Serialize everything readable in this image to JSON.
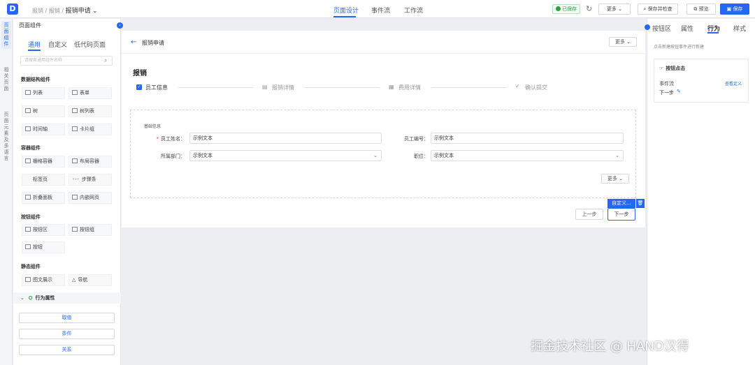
{
  "header": {
    "logo_text": "D",
    "breadcrumb": [
      "报销",
      "报销"
    ],
    "current_page": "报销申请",
    "tabs": [
      {
        "label": "页面设计",
        "active": true
      },
      {
        "label": "事件流"
      },
      {
        "label": "工作流"
      }
    ],
    "saved_label": "已保存",
    "more_label": "更多",
    "save_check_label": "保存并检查",
    "preview_label": "预览",
    "save_label": "保存",
    "accent": "#2468f2"
  },
  "left_strip": {
    "tabs": [
      {
        "label": "页面组件",
        "active": true
      },
      {
        "label": "相关页面"
      },
      {
        "label": "页面元素及多语言"
      }
    ]
  },
  "left_panel": {
    "title": "页面组件",
    "tabs": [
      {
        "label": "通用",
        "active": true
      },
      {
        "label": "自定义"
      },
      {
        "label": "低代码页面"
      }
    ],
    "search_placeholder": "请搜索通用组件名称",
    "groups": [
      {
        "title": "数据结构组件",
        "items": [
          "列表",
          "表单",
          "树",
          "树列表",
          "时间轴",
          "卡片组"
        ]
      },
      {
        "title": "容器组件",
        "items": [
          "栅格容器",
          "布局容器",
          "标签页",
          "步骤条",
          "折叠面板",
          "内嵌网页"
        ]
      },
      {
        "title": "按钮组件",
        "items": [
          "按钮区",
          "按钮组",
          "按钮"
        ]
      },
      {
        "title": "静态组件",
        "items": [
          "图文展示",
          "导航"
        ]
      }
    ],
    "behavior_title": "行为属性",
    "actions": [
      "取值",
      "条件",
      "关系"
    ]
  },
  "canvas": {
    "page_title": "报销申请",
    "more_label": "更多",
    "section_title": "报销",
    "steps": [
      "员工信息",
      "报销详情",
      "费用详情",
      "确认提交"
    ],
    "form_title": "基础信息",
    "fields": [
      {
        "label": "员工姓名：",
        "value": "示例文本",
        "required": true
      },
      {
        "label": "员工编号：",
        "value": "示例文本"
      },
      {
        "label": "所属部门：",
        "value": "示例文本",
        "select": true
      },
      {
        "label": "职位：",
        "value": "示例文本",
        "select": true
      }
    ],
    "form_more_label": "更多",
    "custom_tag": "自定义...",
    "prev_label": "上一步",
    "next_label": "下一步"
  },
  "right_panel": {
    "tabs": [
      {
        "label": "按钮区"
      },
      {
        "label": "属性"
      },
      {
        "label": "行为",
        "active": true
      },
      {
        "label": "样式"
      }
    ],
    "hint": "点击新建按钮事件进行新建",
    "card_title": "按钮点击",
    "event_label": "事件流",
    "event_tag": "查看定义",
    "event_value": "下一步"
  },
  "watermark": "掘金技术社区 @ HAND汉得"
}
